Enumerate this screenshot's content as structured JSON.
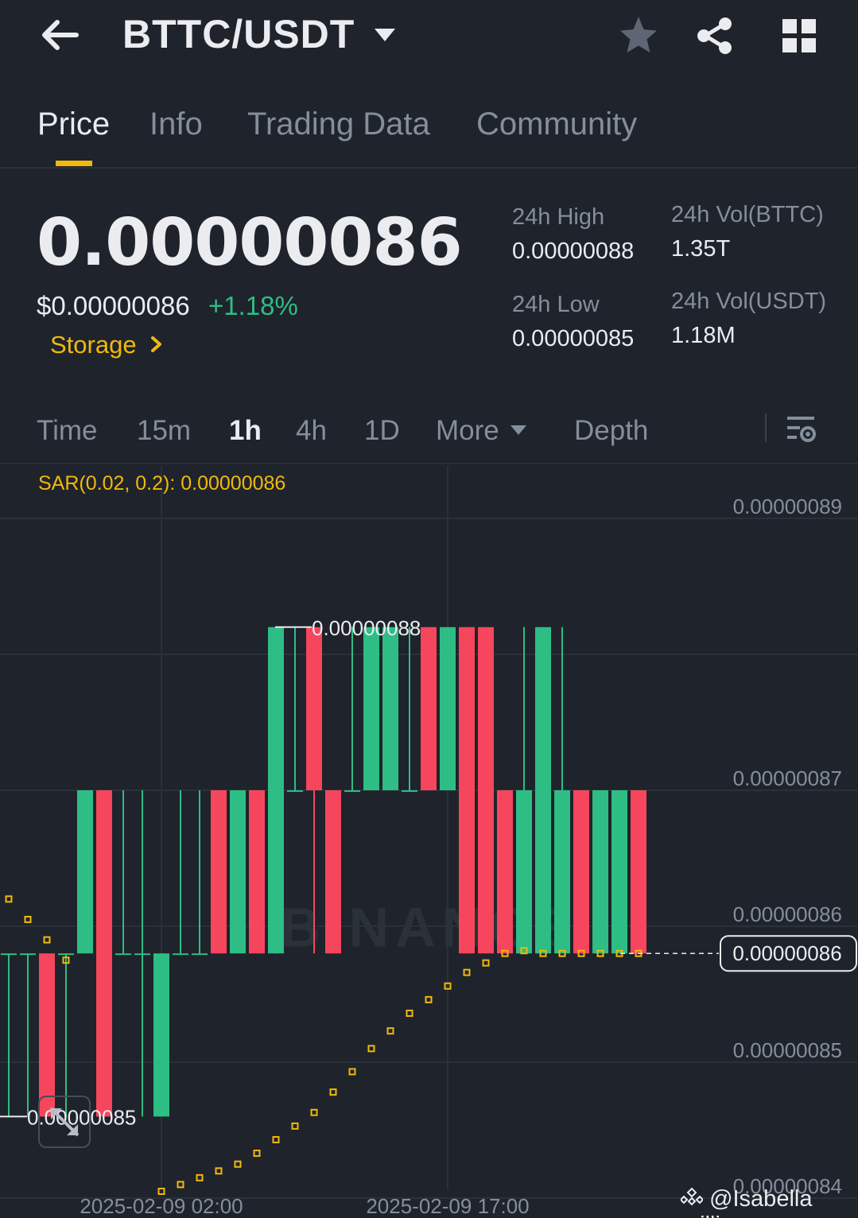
{
  "header": {
    "pair": "BTTC/USDT",
    "icons": {
      "back": "arrow-left-icon",
      "dropdown": "caret-down-icon",
      "favorite": "star-icon",
      "share": "share-icon",
      "menu": "grid-icon"
    }
  },
  "tabs": [
    {
      "label": "Price",
      "active": true
    },
    {
      "label": "Info",
      "active": false
    },
    {
      "label": "Trading Data",
      "active": false
    },
    {
      "label": "Community",
      "active": false
    }
  ],
  "ticker": {
    "last_price": "0.00000086",
    "usd_price": "$0.00000086",
    "change": "+1.18%",
    "tag": "Storage"
  },
  "stats": {
    "high_label": "24h High",
    "high_value": "0.00000088",
    "low_label": "24h Low",
    "low_value": "0.00000085",
    "vol_base_label": "24h Vol(BTTC)",
    "vol_base_value": "1.35T",
    "vol_quote_label": "24h Vol(USDT)",
    "vol_quote_value": "1.18M"
  },
  "intervals": [
    {
      "label": "Time",
      "active": false
    },
    {
      "label": "15m",
      "active": false
    },
    {
      "label": "1h",
      "active": true
    },
    {
      "label": "4h",
      "active": false
    },
    {
      "label": "1D",
      "active": false
    },
    {
      "label": "More",
      "active": false
    },
    {
      "label": "Depth",
      "active": false
    }
  ],
  "colors": {
    "up": "#2ebd85",
    "down": "#f6465d",
    "accent": "#f0b90b",
    "bg": "#1f232b",
    "grid": "#2b3139",
    "muted": "#848e9c"
  },
  "chart_data": {
    "type": "candlestick",
    "indicator_label": "SAR(0.02, 0.2): 0.00000086",
    "y_axis_labels": [
      "0.00000089",
      "0.00000087",
      "0.00000086",
      "0.00000085",
      "0.00000084"
    ],
    "y_ticks": [
      89,
      87,
      86,
      85,
      84
    ],
    "ylim": [
      84,
      89
    ],
    "y_unit_note": "values in units of 1e-8 USDT",
    "x_axis_labels": [
      "2025-02-09 02:00",
      "2025-02-09 17:00"
    ],
    "current_price_label": "0.00000086",
    "current_price": 85.8,
    "high_marker_label": "0.00000088",
    "low_marker_label": "0.00000085",
    "watermark_text": "BINANCE",
    "candles": [
      {
        "o": 85.8,
        "h": 85.8,
        "l": 84.6,
        "c": 85.8
      },
      {
        "o": 85.8,
        "h": 85.8,
        "l": 84.6,
        "c": 85.8
      },
      {
        "o": 85.8,
        "h": 85.8,
        "l": 84.6,
        "c": 84.6
      },
      {
        "o": 85.8,
        "h": 85.8,
        "l": 84.6,
        "c": 85.8
      },
      {
        "o": 85.8,
        "h": 87.0,
        "l": 85.8,
        "c": 87.0
      },
      {
        "o": 87.0,
        "h": 87.0,
        "l": 84.6,
        "c": 84.6
      },
      {
        "o": 85.8,
        "h": 87.0,
        "l": 85.8,
        "c": 85.8
      },
      {
        "o": 85.8,
        "h": 87.0,
        "l": 84.6,
        "c": 85.8
      },
      {
        "o": 84.6,
        "h": 85.8,
        "l": 84.6,
        "c": 85.8
      },
      {
        "o": 85.8,
        "h": 87.0,
        "l": 85.8,
        "c": 85.8
      },
      {
        "o": 85.8,
        "h": 87.0,
        "l": 85.8,
        "c": 85.8
      },
      {
        "o": 87.0,
        "h": 87.0,
        "l": 85.8,
        "c": 85.8
      },
      {
        "o": 85.8,
        "h": 87.0,
        "l": 85.8,
        "c": 87.0
      },
      {
        "o": 87.0,
        "h": 87.0,
        "l": 85.8,
        "c": 85.8
      },
      {
        "o": 85.8,
        "h": 88.2,
        "l": 85.8,
        "c": 88.2
      },
      {
        "o": 87.0,
        "h": 88.2,
        "l": 87.0,
        "c": 87.0
      },
      {
        "o": 88.2,
        "h": 88.2,
        "l": 85.8,
        "c": 87.0
      },
      {
        "o": 87.0,
        "h": 87.0,
        "l": 85.8,
        "c": 85.8
      },
      {
        "o": 87.0,
        "h": 88.2,
        "l": 87.0,
        "c": 87.0
      },
      {
        "o": 87.0,
        "h": 88.2,
        "l": 87.0,
        "c": 88.2
      },
      {
        "o": 87.0,
        "h": 88.2,
        "l": 87.0,
        "c": 88.2
      },
      {
        "o": 87.0,
        "h": 88.2,
        "l": 87.0,
        "c": 87.0
      },
      {
        "o": 88.2,
        "h": 88.2,
        "l": 87.0,
        "c": 87.0
      },
      {
        "o": 87.0,
        "h": 88.2,
        "l": 87.0,
        "c": 88.2
      },
      {
        "o": 88.2,
        "h": 88.2,
        "l": 85.8,
        "c": 85.8
      },
      {
        "o": 88.2,
        "h": 88.2,
        "l": 85.8,
        "c": 85.8
      },
      {
        "o": 87.0,
        "h": 87.0,
        "l": 85.8,
        "c": 85.8
      },
      {
        "o": 85.8,
        "h": 88.2,
        "l": 85.8,
        "c": 87.0
      },
      {
        "o": 85.8,
        "h": 88.2,
        "l": 85.8,
        "c": 88.2
      },
      {
        "o": 85.8,
        "h": 88.2,
        "l": 85.8,
        "c": 87.0
      },
      {
        "o": 87.0,
        "h": 87.0,
        "l": 85.8,
        "c": 85.8
      },
      {
        "o": 85.8,
        "h": 87.0,
        "l": 85.8,
        "c": 87.0
      },
      {
        "o": 85.8,
        "h": 87.0,
        "l": 85.8,
        "c": 87.0
      },
      {
        "o": 87.0,
        "h": 87.0,
        "l": 85.8,
        "c": 85.8
      }
    ],
    "sar": [
      86.2,
      86.05,
      85.9,
      85.75,
      null,
      null,
      null,
      null,
      84.05,
      84.1,
      84.15,
      84.2,
      84.25,
      84.33,
      84.43,
      84.53,
      84.63,
      84.78,
      84.93,
      85.1,
      85.23,
      85.36,
      85.46,
      85.56,
      85.66,
      85.73,
      85.8,
      85.82,
      85.8,
      85.8,
      85.8,
      85.8,
      85.8,
      85.8
    ]
  },
  "footer": {
    "watermark": "@Isabella millie"
  }
}
